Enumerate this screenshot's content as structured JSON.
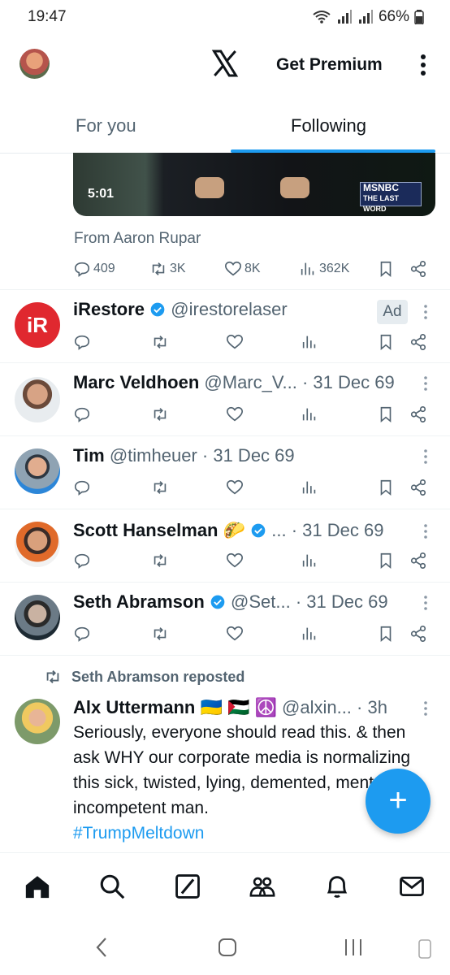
{
  "status_bar": {
    "time": "19:47",
    "battery": "66%"
  },
  "header": {
    "premium_label": "Get Premium"
  },
  "tabs": [
    {
      "label": "For you"
    },
    {
      "label": "Following"
    }
  ],
  "video_post": {
    "duration": "5:01",
    "channel_badge_line1": "MSNBC",
    "channel_badge_line2": "THE LAST WORD",
    "from_text": "From Aaron Rupar",
    "replies": "409",
    "reposts": "3K",
    "likes": "8K",
    "views": "362K"
  },
  "posts": [
    {
      "name": "iRestore",
      "handle": "@irestorelaser",
      "ad_label": "Ad",
      "avatar_text": "iR"
    },
    {
      "name": "Marc Veldhoen",
      "handle": "@Marc_V...",
      "date": "· 31 Dec 69"
    },
    {
      "name": "Tim",
      "handle": "@timheuer",
      "date": "· 31 Dec 69"
    },
    {
      "name": "Scott Hanselman 🌮",
      "handle": "...",
      "date": "· 31 Dec 69"
    },
    {
      "name": "Seth Abramson",
      "handle": "@Set...",
      "date": "· 31 Dec 69"
    }
  ],
  "repost": {
    "reposted_by": "Seth Abramson reposted",
    "name": "Alx Uttermann 🇺🇦 🇵🇸 ☮️",
    "handle": "@alxin...",
    "time": "· 3h",
    "text": "Seriously, everyone should read this. & then ask WHY our corporate media is normalizing this sick, twisted, lying, demented, mentally incompetent man.",
    "link_fragment": "#TrumpMeltdown"
  },
  "icons": {
    "reply": "reply-icon",
    "repost": "repost-icon",
    "like": "like-icon",
    "views": "views-icon",
    "bookmark": "bookmark-icon",
    "share": "share-icon"
  },
  "colors": {
    "accent": "#1d9bf0",
    "text": "#0f1419",
    "secondary": "#536471",
    "irestore": "#e0282f"
  }
}
